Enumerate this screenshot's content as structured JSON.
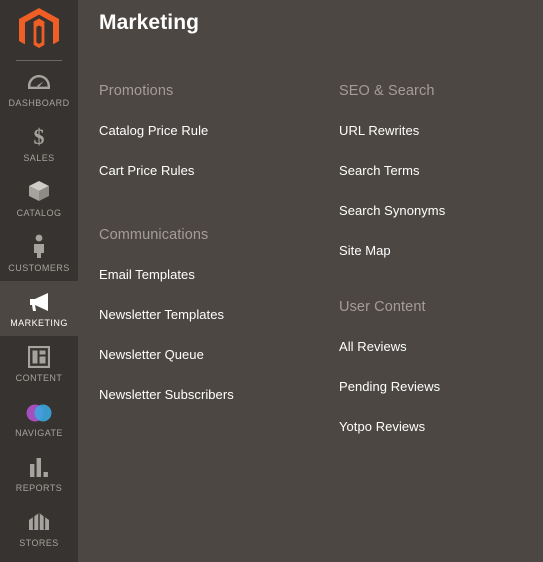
{
  "sidebar": {
    "logo": {
      "icon": "magento-logo-icon",
      "color": "#ee5e25"
    },
    "items": [
      {
        "id": "dashboard",
        "label": "DASHBOARD",
        "icon": "dashboard-gauge-icon",
        "active": false
      },
      {
        "id": "sales",
        "label": "SALES",
        "icon": "dollar-sign-icon",
        "active": false
      },
      {
        "id": "catalog",
        "label": "CATALOG",
        "icon": "box-icon",
        "active": false
      },
      {
        "id": "customers",
        "label": "CUSTOMERS",
        "icon": "person-icon",
        "active": false
      },
      {
        "id": "marketing",
        "label": "MARKETING",
        "icon": "megaphone-icon",
        "active": true
      },
      {
        "id": "content",
        "label": "CONTENT",
        "icon": "page-layout-icon",
        "active": false
      },
      {
        "id": "navigate",
        "label": "NAVIGATE",
        "icon": "venn-circles-icon",
        "active": false
      },
      {
        "id": "reports",
        "label": "REPORTS",
        "icon": "bar-chart-icon",
        "active": false
      },
      {
        "id": "stores",
        "label": "STORES",
        "icon": "storefront-icon",
        "active": false
      }
    ]
  },
  "main": {
    "title": "Marketing",
    "columns": [
      {
        "id": "left",
        "groups": [
          {
            "id": "promotions",
            "title": "Promotions",
            "items": [
              {
                "label": "Catalog Price Rule"
              },
              {
                "label": "Cart Price Rules"
              }
            ]
          },
          {
            "id": "communications",
            "title": "Communications",
            "items": [
              {
                "label": "Email Templates"
              },
              {
                "label": "Newsletter Templates"
              },
              {
                "label": "Newsletter Queue"
              },
              {
                "label": "Newsletter Subscribers"
              }
            ]
          }
        ]
      },
      {
        "id": "right",
        "groups": [
          {
            "id": "seo-search",
            "title": "SEO & Search",
            "items": [
              {
                "label": "URL Rewrites"
              },
              {
                "label": "Search Terms"
              },
              {
                "label": "Search Synonyms"
              },
              {
                "label": "Site Map"
              }
            ]
          },
          {
            "id": "user-content",
            "title": "User Content",
            "items": [
              {
                "label": "All Reviews"
              },
              {
                "label": "Pending Reviews"
              },
              {
                "label": "Yotpo Reviews"
              }
            ]
          }
        ]
      }
    ]
  },
  "colors": {
    "sidebar_bg": "#373330",
    "panel_bg": "#4c4742",
    "accent_orange": "#ee5e25",
    "group_title": "#a49d97",
    "link_text": "#ffffff",
    "nav_label": "#a6a29e",
    "navigate_purple": "#a44fbc",
    "navigate_blue": "#3aa8e0"
  }
}
